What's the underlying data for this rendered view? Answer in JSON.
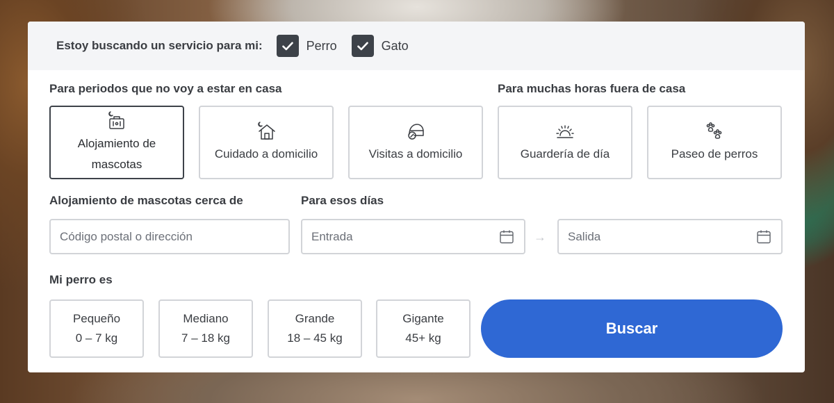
{
  "pet_filter": {
    "prompt": "Estoy buscando un servicio para mi:",
    "options": [
      {
        "label": "Perro",
        "checked": true
      },
      {
        "label": "Gato",
        "checked": true
      }
    ]
  },
  "services": {
    "away_label": "Para periodos que no voy a estar en casa",
    "out_label": "Para muchas horas fuera de casa",
    "items": [
      {
        "label": "Alojamiento de mascotas",
        "icon": "pet-boarding-icon",
        "selected": true
      },
      {
        "label": "Cuidado a domicilio",
        "icon": "house-sitting-icon",
        "selected": false
      },
      {
        "label": "Visitas a domicilio",
        "icon": "drop-in-visits-icon",
        "selected": false
      },
      {
        "label": "Guardería de día",
        "icon": "day-care-icon",
        "selected": false
      },
      {
        "label": "Paseo de perros",
        "icon": "dog-walking-icon",
        "selected": false
      }
    ]
  },
  "location": {
    "label": "Alojamiento de mascotas cerca de",
    "placeholder": "Código postal o dirección"
  },
  "dates": {
    "label": "Para esos días",
    "start_placeholder": "Entrada",
    "end_placeholder": "Salida",
    "arrow": "→"
  },
  "dog_size": {
    "label": "Mi perro es",
    "options": [
      {
        "name": "Pequeño",
        "range": "0 – 7 kg"
      },
      {
        "name": "Mediano",
        "range": "7 – 18 kg"
      },
      {
        "name": "Grande",
        "range": "18 – 45 kg"
      },
      {
        "name": "Gigante",
        "range": "45+ kg"
      }
    ]
  },
  "search_button": "Buscar",
  "colors": {
    "accent": "#2f68d4",
    "checkbox": "#3d4249",
    "border": "#d2d4d8",
    "topbar_bg": "#f4f5f7"
  }
}
